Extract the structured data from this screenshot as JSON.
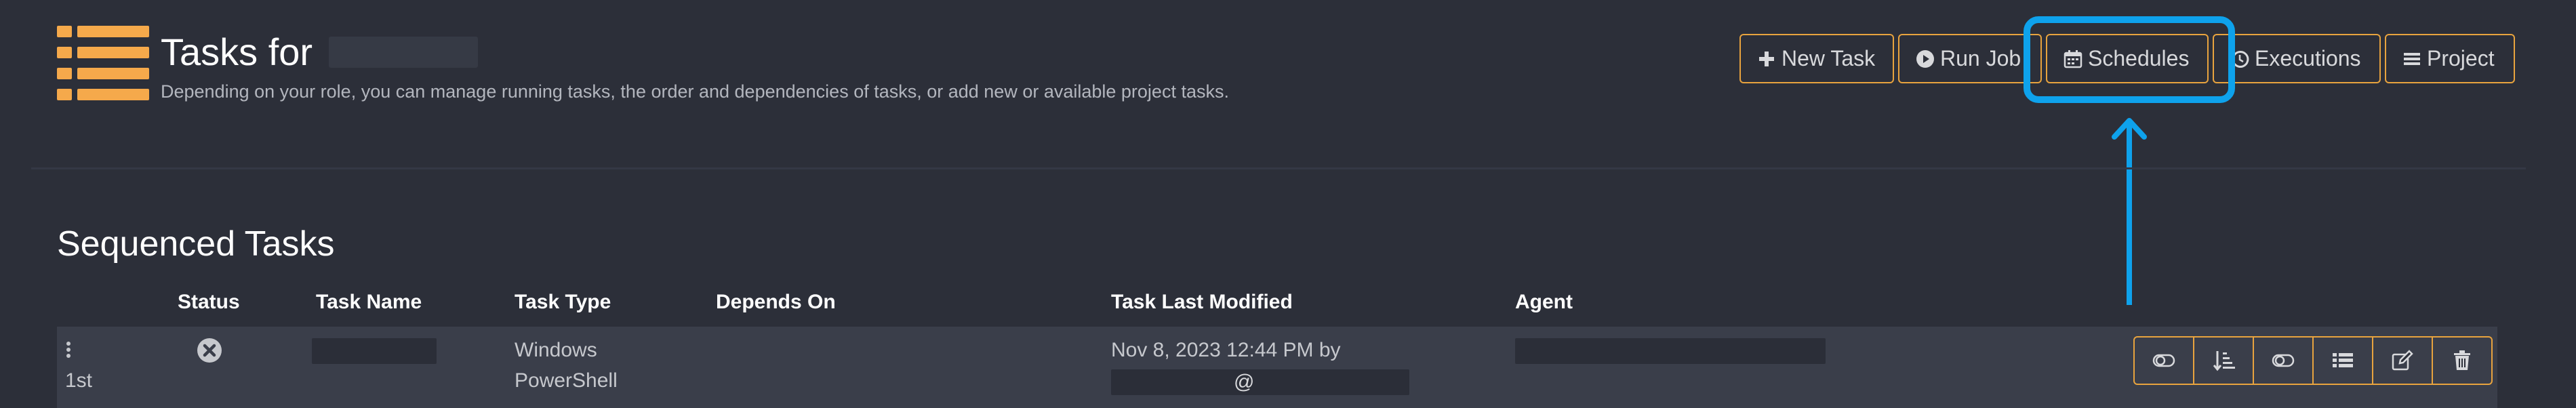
{
  "header": {
    "title": "Tasks for",
    "subtitle": "Depending on your role, you can manage running tasks, the order and dependencies of tasks, or add new or available project tasks.",
    "icon": "list-icon",
    "accent_color": "#f5a94b"
  },
  "toolbar": {
    "new_task": "New Task",
    "run_job": "Run Job",
    "schedules": "Schedules",
    "executions": "Executions",
    "project": "Project",
    "border_color": "#e8a33e"
  },
  "annotation": {
    "highlight_color": "#0ea2ec",
    "target": "schedules-button"
  },
  "section": {
    "title": "Sequenced Tasks"
  },
  "table": {
    "columns": [
      "Status",
      "Task Name",
      "Task Type",
      "Depends On",
      "Task Last Modified",
      "Agent"
    ],
    "rows": [
      {
        "order": "1st",
        "status_icon": "circle-x-icon",
        "task_type_line1": "Windows",
        "task_type_line2": "PowerShell",
        "depends_on": "",
        "modified_line1": "Nov 8, 2023 12:44 PM by",
        "modified_at": "@",
        "actions": [
          "toggle-icon",
          "sort-icon",
          "toggle-icon",
          "list-icon",
          "edit-icon",
          "trash-icon"
        ]
      }
    ]
  }
}
